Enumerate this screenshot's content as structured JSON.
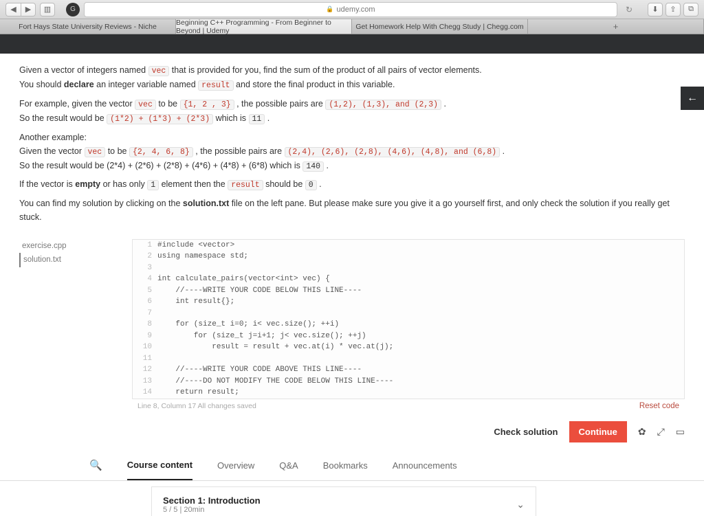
{
  "browser": {
    "url_host": "udemy.com",
    "tabs": [
      "Fort Hays State University Reviews - Niche",
      "Beginning C++ Programming - From Beginner to Beyond | Udemy",
      "Get Homework Help With Chegg Study | Chegg.com"
    ]
  },
  "desc": {
    "p1a": "Given a vector of integers named ",
    "p1b": " that is provided for you, find the sum of the product of all pairs of vector elements.",
    "p2a": "You should ",
    "p2_bold": "declare",
    "p2b": " an integer variable named ",
    "p2c": " and store the final product in this variable.",
    "p3a": "For example, given the vector ",
    "p3b": " to be ",
    "p3c": " , the possible pairs are ",
    "p3d": " .",
    "p4a": "So the result would be ",
    "p4b": " which is ",
    "p4c": " .",
    "p5": "Another example:",
    "p6a": "Given the vector ",
    "p6b": " to be ",
    "p6c": " , the possible pairs are ",
    "p6d": " .",
    "p7a": "So the result would be (2*4) + (2*6) + (2*8) + (4*6) + (4*8) + (6*8) which is ",
    "p7b": " .",
    "p8a": "If the vector is ",
    "p8_bold": "empty",
    "p8b": " or has only ",
    "p8c": " element then the ",
    "p8d": " should be ",
    "p8e": " .",
    "p9a": "You can find my solution by clicking on the ",
    "p9_bold": "solution.txt",
    "p9b": " file on the left pane. But please make sure you give it a go yourself first, and only check the solution if you really get stuck.",
    "code": {
      "vec": "vec",
      "result": "result",
      "set1": "{1, 2 , 3}",
      "pairs1": "(1,2), (1,3), and (2,3)",
      "sum1": "(1*2) + (1*3) + (2*3)",
      "res1": "11",
      "set2": "{2, 4, 6, 8}",
      "pairs2": "(2,4), (2,6), (2,8), (4,6), (4,8), and (6,8)",
      "res2": "140",
      "one": "1",
      "zero": "0"
    }
  },
  "files": {
    "a": "exercise.cpp",
    "b": "solution.txt"
  },
  "editor": {
    "lines": [
      "#include <vector>",
      "using namespace std;",
      "",
      "int calculate_pairs(vector<int> vec) {",
      "    //----WRITE YOUR CODE BELOW THIS LINE----",
      "    int result{};",
      "",
      "    for (size_t i=0; i< vec.size(); ++i)",
      "        for (size_t j=i+1; j< vec.size(); ++j)",
      "            result = result + vec.at(i) * vec.at(j);",
      "",
      "    //----WRITE YOUR CODE ABOVE THIS LINE----",
      "    //----DO NOT MODIFY THE CODE BELOW THIS LINE----",
      "    return result;"
    ],
    "status": "Line 8, Column 17    All changes saved",
    "reset": "Reset code"
  },
  "actions": {
    "check": "Check solution",
    "continue": "Continue"
  },
  "tabset": {
    "t1": "Course content",
    "t2": "Overview",
    "t3": "Q&A",
    "t4": "Bookmarks",
    "t5": "Announcements"
  },
  "section": {
    "title": "Section 1: Introduction",
    "sub": "5 / 5 | 20min"
  }
}
